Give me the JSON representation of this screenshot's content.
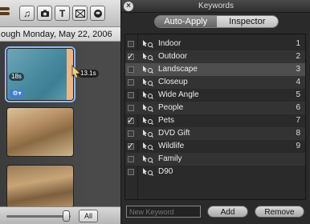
{
  "left": {
    "toolbar_icons": [
      "music-icon",
      "camera-icon",
      "title-icon",
      "transitions-icon",
      "effects-icon"
    ],
    "title_glyph": "T",
    "date_label": "ough Monday, May 22, 2006",
    "clips": [
      {
        "duration": "18s",
        "drag_duration": "13.1s"
      },
      {},
      {}
    ],
    "all_label": "All",
    "slider": {
      "level": 0.95
    }
  },
  "panel": {
    "title": "Keywords",
    "tabs": [
      {
        "label": "Auto-Apply",
        "active": true
      },
      {
        "label": "Inspector",
        "active": false
      }
    ],
    "keywords": [
      {
        "name": "Indoor",
        "checked": false,
        "shortcut": "1"
      },
      {
        "name": "Outdoor",
        "checked": true,
        "shortcut": "2"
      },
      {
        "name": "Landscape",
        "checked": false,
        "shortcut": "3",
        "selected": true
      },
      {
        "name": "Closeup",
        "checked": false,
        "shortcut": "4"
      },
      {
        "name": "Wide Angle",
        "checked": false,
        "shortcut": "5"
      },
      {
        "name": "People",
        "checked": false,
        "shortcut": "6"
      },
      {
        "name": "Pets",
        "checked": true,
        "shortcut": "7"
      },
      {
        "name": "DVD Gift",
        "checked": false,
        "shortcut": "8"
      },
      {
        "name": "Wildlife",
        "checked": true,
        "shortcut": "9"
      },
      {
        "name": "Family",
        "checked": false,
        "shortcut": ""
      },
      {
        "name": "D90",
        "checked": false,
        "shortcut": ""
      }
    ],
    "new_keyword_placeholder": "New Keyword",
    "add_label": "Add",
    "remove_label": "Remove",
    "check_glyph": "✓"
  }
}
